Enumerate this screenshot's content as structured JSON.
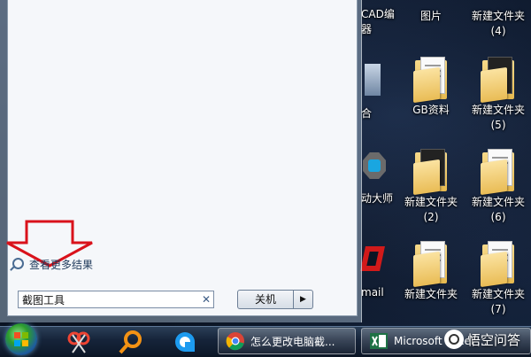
{
  "desktop": {
    "icons": [
      {
        "label": "CAD编\n器",
        "kind": "cad"
      },
      {
        "label": "图片",
        "kind": "folder-dark"
      },
      {
        "label": "新建文件夹\n(4)",
        "kind": "folder"
      },
      {
        "label": "合",
        "kind": "generic"
      },
      {
        "label": "GB资料",
        "kind": "folder"
      },
      {
        "label": "新建文件夹\n(5)",
        "kind": "folder"
      },
      {
        "label": "动大师",
        "kind": "gear"
      },
      {
        "label": "新建文件夹\n(2)",
        "kind": "folder-dark"
      },
      {
        "label": "新建文件夹\n(6)",
        "kind": "folder"
      },
      {
        "label": "mail",
        "kind": "mail"
      },
      {
        "label": "新建文件夹",
        "kind": "folder"
      },
      {
        "label": "新建文件夹\n(7)",
        "kind": "folder"
      }
    ]
  },
  "start_menu": {
    "see_more_label": "查看更多结果",
    "search": {
      "value": "截图工具",
      "placeholder": ""
    },
    "shutdown_label": "关机",
    "shutdown_arrow": "▶"
  },
  "taskbar": {
    "pinned": [
      "snipping-tool-icon",
      "search-magnifier-icon",
      "sync-app-icon"
    ],
    "apps": [
      {
        "label": "怎么更改电脑截...",
        "icon": "chrome-icon"
      },
      {
        "label": "Microsoft Excel ...",
        "icon": "excel-icon"
      }
    ]
  },
  "watermark": {
    "text": "悟空问答"
  },
  "colors": {
    "annotation_arrow": "#d9121b",
    "taskbar": "#16243a",
    "menu_bg": "#f5f7fa"
  }
}
